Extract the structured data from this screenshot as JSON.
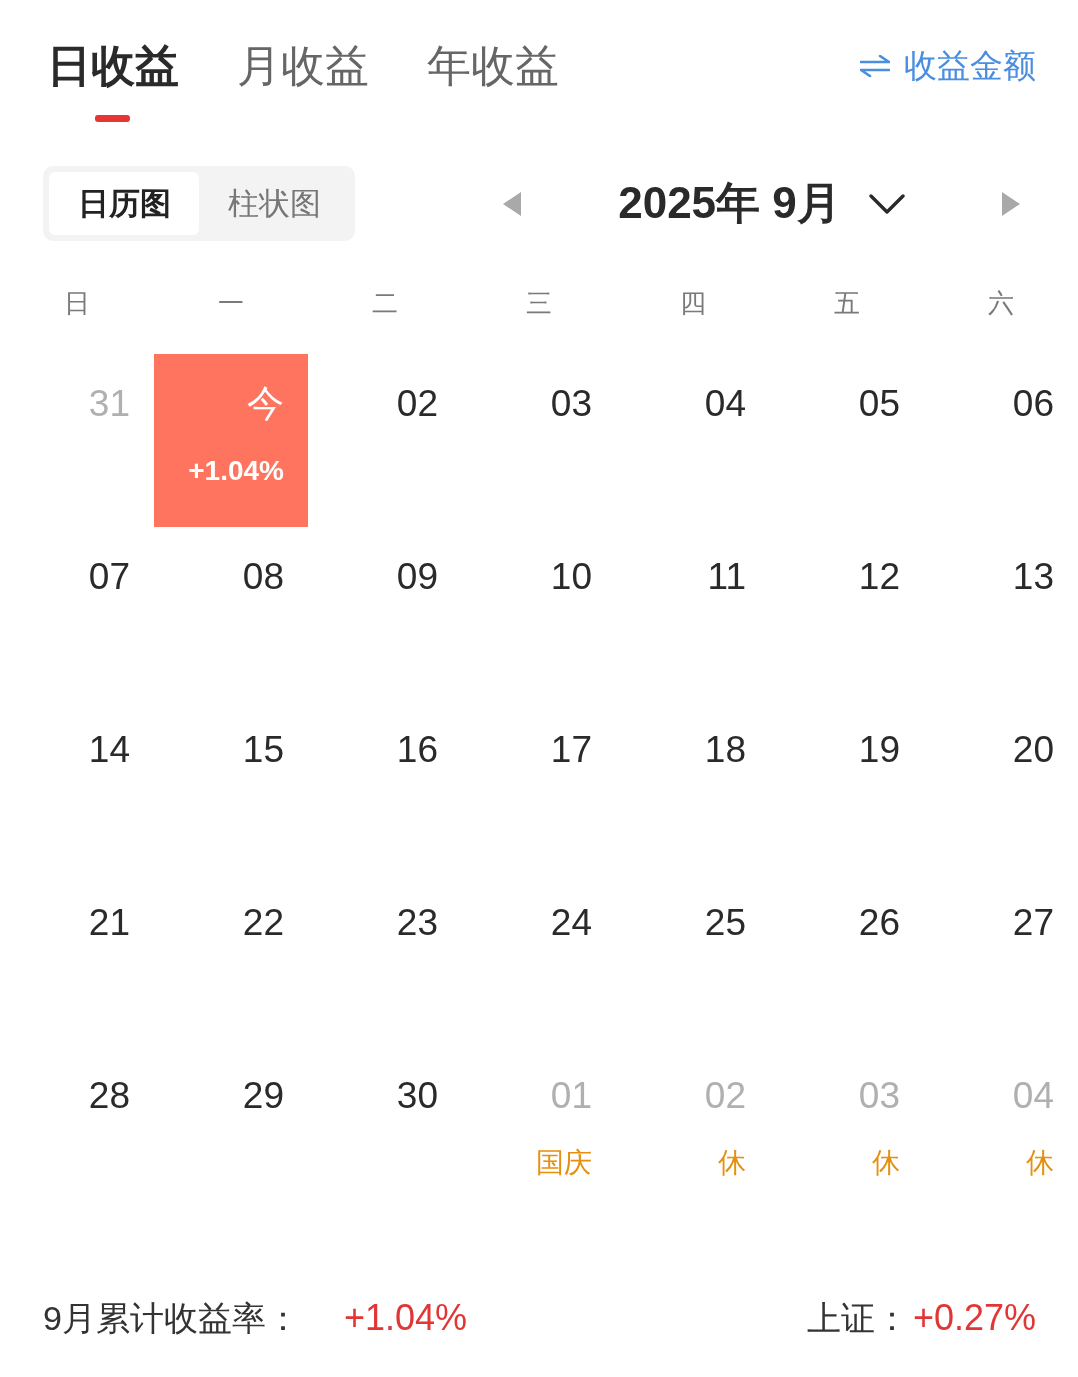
{
  "tabs": [
    {
      "label": "日收益",
      "selected": true
    },
    {
      "label": "月收益",
      "selected": false
    },
    {
      "label": "年收益",
      "selected": false
    }
  ],
  "metric_switch": {
    "label": "收益金额"
  },
  "view_toggle": [
    {
      "label": "日历图",
      "selected": true
    },
    {
      "label": "柱状图",
      "selected": false
    }
  ],
  "month_nav": {
    "title": "2025年 9月"
  },
  "calendar": {
    "weekdays": [
      "日",
      "一",
      "二",
      "三",
      "四",
      "五",
      "六"
    ],
    "weeks": [
      [
        {
          "day": "31",
          "in_month": false,
          "selected": false
        },
        {
          "day": "今",
          "in_month": true,
          "selected": true,
          "return": "+1.04%"
        },
        {
          "day": "02",
          "in_month": true,
          "selected": false
        },
        {
          "day": "03",
          "in_month": true,
          "selected": false
        },
        {
          "day": "04",
          "in_month": true,
          "selected": false
        },
        {
          "day": "05",
          "in_month": true,
          "selected": false
        },
        {
          "day": "06",
          "in_month": true,
          "selected": false
        }
      ],
      [
        {
          "day": "07",
          "in_month": true,
          "selected": false
        },
        {
          "day": "08",
          "in_month": true,
          "selected": false
        },
        {
          "day": "09",
          "in_month": true,
          "selected": false
        },
        {
          "day": "10",
          "in_month": true,
          "selected": false
        },
        {
          "day": "11",
          "in_month": true,
          "selected": false
        },
        {
          "day": "12",
          "in_month": true,
          "selected": false
        },
        {
          "day": "13",
          "in_month": true,
          "selected": false
        }
      ],
      [
        {
          "day": "14",
          "in_month": true,
          "selected": false
        },
        {
          "day": "15",
          "in_month": true,
          "selected": false
        },
        {
          "day": "16",
          "in_month": true,
          "selected": false
        },
        {
          "day": "17",
          "in_month": true,
          "selected": false
        },
        {
          "day": "18",
          "in_month": true,
          "selected": false
        },
        {
          "day": "19",
          "in_month": true,
          "selected": false
        },
        {
          "day": "20",
          "in_month": true,
          "selected": false
        }
      ],
      [
        {
          "day": "21",
          "in_month": true,
          "selected": false
        },
        {
          "day": "22",
          "in_month": true,
          "selected": false
        },
        {
          "day": "23",
          "in_month": true,
          "selected": false
        },
        {
          "day": "24",
          "in_month": true,
          "selected": false
        },
        {
          "day": "25",
          "in_month": true,
          "selected": false
        },
        {
          "day": "26",
          "in_month": true,
          "selected": false
        },
        {
          "day": "27",
          "in_month": true,
          "selected": false
        }
      ],
      [
        {
          "day": "28",
          "in_month": true,
          "selected": false
        },
        {
          "day": "29",
          "in_month": true,
          "selected": false
        },
        {
          "day": "30",
          "in_month": true,
          "selected": false
        },
        {
          "day": "01",
          "in_month": false,
          "selected": false,
          "note": "国庆"
        },
        {
          "day": "02",
          "in_month": false,
          "selected": false,
          "note": "休"
        },
        {
          "day": "03",
          "in_month": false,
          "selected": false,
          "note": "休"
        },
        {
          "day": "04",
          "in_month": false,
          "selected": false,
          "note": "休"
        }
      ]
    ]
  },
  "summary": [
    {
      "label": "9月累计收益率：",
      "value": "+1.04%"
    },
    {
      "label": "上证：",
      "value": "+0.27%"
    }
  ]
}
